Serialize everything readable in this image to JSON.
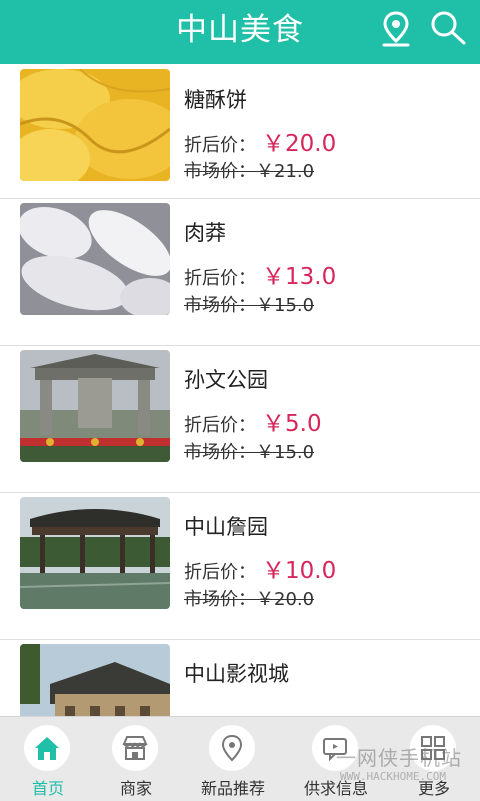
{
  "header": {
    "title": "中山美食"
  },
  "items": [
    {
      "name": "糖酥饼",
      "discount_label": "折后价：",
      "discount_price": "￥20.0",
      "market_label": "市场价：",
      "market_price": "￥21.0"
    },
    {
      "name": "肉莽",
      "discount_label": "折后价：",
      "discount_price": "￥13.0",
      "market_label": "市场价：",
      "market_price": "￥15.0"
    },
    {
      "name": "孙文公园",
      "discount_label": "折后价：",
      "discount_price": "￥5.0",
      "market_label": "市场价：",
      "market_price": "￥15.0"
    },
    {
      "name": "中山詹园",
      "discount_label": "折后价：",
      "discount_price": "￥10.0",
      "market_label": "市场价：",
      "market_price": "￥20.0"
    },
    {
      "name": "中山影视城"
    }
  ],
  "tabs": [
    {
      "label": "首页"
    },
    {
      "label": "商家"
    },
    {
      "label": "新品推荐"
    },
    {
      "label": "供求信息"
    },
    {
      "label": "更多"
    }
  ],
  "watermark": {
    "text": "一网侠手机站",
    "sub": "WWW.HACKHOME.COM"
  },
  "colors": {
    "accent": "#1fbfa8",
    "price": "#d6265a"
  }
}
